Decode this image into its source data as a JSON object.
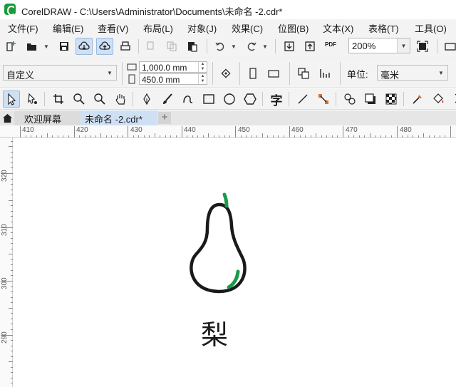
{
  "window": {
    "title": "CorelDRAW - C:\\Users\\Administrator\\Documents\\未命名 -2.cdr*"
  },
  "menu": [
    {
      "label": "文件(F)"
    },
    {
      "label": "编辑(E)"
    },
    {
      "label": "查看(V)"
    },
    {
      "label": "布局(L)"
    },
    {
      "label": "对象(J)"
    },
    {
      "label": "效果(C)"
    },
    {
      "label": "位图(B)"
    },
    {
      "label": "文本(X)"
    },
    {
      "label": "表格(T)"
    },
    {
      "label": "工具(O)"
    }
  ],
  "standard_toolbar": {
    "zoom_value": "200%",
    "pdf_label": "PDF"
  },
  "property_bar": {
    "page_preset": "自定义",
    "page_width": "1,000.0 mm",
    "page_height": "450.0 mm",
    "units_label": "单位:",
    "units_value": "毫米"
  },
  "toolbox": {
    "text_tool_glyph": "字"
  },
  "tabs": [
    {
      "label": "欢迎屏幕",
      "active": false
    },
    {
      "label": "未命名 -2.cdr*",
      "active": true
    }
  ],
  "rulers": {
    "horizontal_labels": [
      "410",
      "420",
      "430",
      "440",
      "450",
      "460",
      "470",
      "480"
    ],
    "vertical_labels": [
      "320",
      "310",
      "300",
      "290"
    ]
  },
  "canvas": {
    "caption": "梨",
    "pear_outline_color": "#1a1a1a",
    "pear_accent_color": "#1a9a4a"
  }
}
